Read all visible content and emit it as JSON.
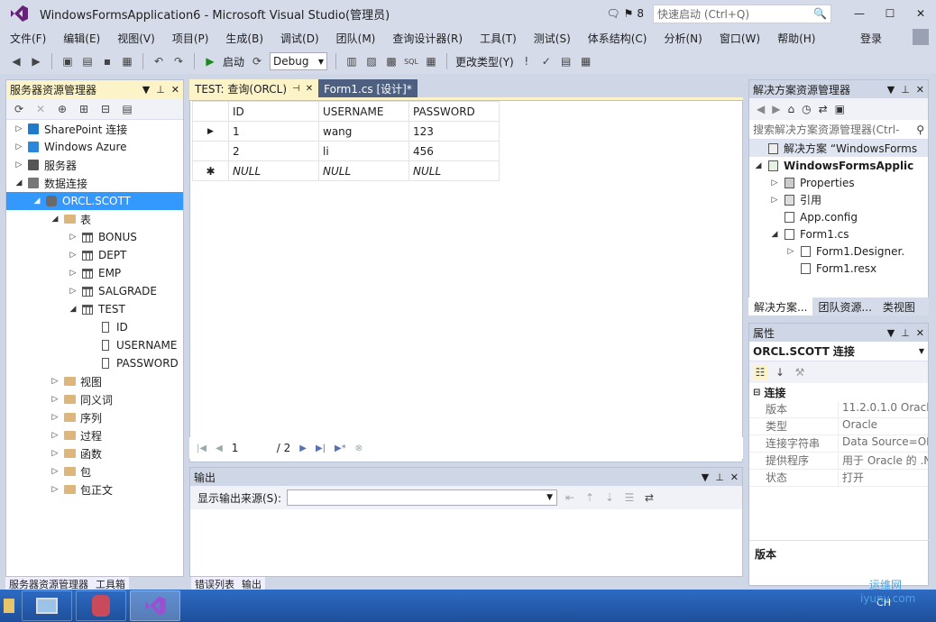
{
  "window": {
    "title": "WindowsFormsApplication6 - Microsoft Visual Studio(管理员)",
    "notification_count": "8",
    "quick_launch_placeholder": "快速启动 (Ctrl+Q)"
  },
  "menu": {
    "items": [
      "文件(F)",
      "编辑(E)",
      "视图(V)",
      "项目(P)",
      "生成(B)",
      "调试(D)",
      "团队(M)",
      "查询设计器(R)",
      "工具(T)",
      "测试(S)",
      "体系结构(C)",
      "分析(N)",
      "窗口(W)",
      "帮助(H)"
    ],
    "login": "登录"
  },
  "toolbar": {
    "start_label": "启动",
    "config": "Debug",
    "change_type": "更改类型(Y)"
  },
  "server_explorer": {
    "title": "服务器资源管理器",
    "tree": [
      {
        "label": "SharePoint 连接",
        "level": 0,
        "arrow": "collapsed",
        "icon": "sharepoint-icon"
      },
      {
        "label": "Windows Azure",
        "level": 0,
        "arrow": "collapsed",
        "icon": "azure-icon"
      },
      {
        "label": "服务器",
        "level": 0,
        "arrow": "collapsed",
        "icon": "server-icon"
      },
      {
        "label": "数据连接",
        "level": 0,
        "arrow": "expanded",
        "icon": "data-connection-icon"
      },
      {
        "label": "ORCL.SCOTT",
        "level": 1,
        "arrow": "expanded",
        "icon": "database-icon",
        "selected": true
      },
      {
        "label": "表",
        "level": 2,
        "arrow": "expanded",
        "icon": "folder-icon"
      },
      {
        "label": "BONUS",
        "level": 3,
        "arrow": "collapsed",
        "icon": "table-icon"
      },
      {
        "label": "DEPT",
        "level": 3,
        "arrow": "collapsed",
        "icon": "table-icon"
      },
      {
        "label": "EMP",
        "level": 3,
        "arrow": "collapsed",
        "icon": "table-icon"
      },
      {
        "label": "SALGRADE",
        "level": 3,
        "arrow": "collapsed",
        "icon": "table-icon"
      },
      {
        "label": "TEST",
        "level": 3,
        "arrow": "expanded",
        "icon": "table-icon"
      },
      {
        "label": "ID",
        "level": 4,
        "arrow": "none",
        "icon": "column-icon"
      },
      {
        "label": "USERNAME",
        "level": 4,
        "arrow": "none",
        "icon": "column-icon"
      },
      {
        "label": "PASSWORD",
        "level": 4,
        "arrow": "none",
        "icon": "column-icon"
      },
      {
        "label": "视图",
        "level": 2,
        "arrow": "collapsed",
        "icon": "folder-icon"
      },
      {
        "label": "同义词",
        "level": 2,
        "arrow": "collapsed",
        "icon": "folder-icon"
      },
      {
        "label": "序列",
        "level": 2,
        "arrow": "collapsed",
        "icon": "folder-icon"
      },
      {
        "label": "过程",
        "level": 2,
        "arrow": "collapsed",
        "icon": "folder-icon"
      },
      {
        "label": "函数",
        "level": 2,
        "arrow": "collapsed",
        "icon": "folder-icon"
      },
      {
        "label": "包",
        "level": 2,
        "arrow": "collapsed",
        "icon": "folder-icon"
      },
      {
        "label": "包正文",
        "level": 2,
        "arrow": "collapsed",
        "icon": "folder-icon"
      }
    ],
    "bottom_tabs": [
      "服务器资源管理器",
      "工具箱"
    ]
  },
  "doc_tabs": [
    {
      "label": "TEST: 查询(ORCL)",
      "active": true
    },
    {
      "label": "Form1.cs [设计]*",
      "active": false
    }
  ],
  "grid": {
    "columns": [
      "ID",
      "USERNAME",
      "PASSWORD"
    ],
    "rows": [
      {
        "marker": "▶",
        "cells": [
          "1",
          "wang",
          "123"
        ],
        "null": false
      },
      {
        "marker": "",
        "cells": [
          "2",
          "li",
          "456"
        ],
        "null": false
      },
      {
        "marker": "✱",
        "cells": [
          "NULL",
          "NULL",
          "NULL"
        ],
        "null": true
      }
    ],
    "pager": {
      "current": "1",
      "total": "/ 2"
    }
  },
  "output": {
    "title": "输出",
    "source_label": "显示输出来源(S):",
    "bottom_tabs": [
      "错误列表",
      "输出"
    ]
  },
  "solution_explorer": {
    "title": "解决方案资源管理器",
    "search_placeholder": "搜索解决方案资源管理器(Ctrl-",
    "tree": [
      {
        "label": "解决方案 “WindowsForms",
        "level": 0,
        "arrow": "none",
        "icon": "solution-icon"
      },
      {
        "label": "WindowsFormsApplic",
        "level": 0,
        "arrow": "expanded",
        "icon": "csharp-project-icon",
        "bold": true
      },
      {
        "label": "Properties",
        "level": 1,
        "arrow": "collapsed",
        "icon": "wrench-icon"
      },
      {
        "label": "引用",
        "level": 1,
        "arrow": "collapsed",
        "icon": "references-icon"
      },
      {
        "label": "App.config",
        "level": 1,
        "arrow": "none",
        "icon": "config-icon"
      },
      {
        "label": "Form1.cs",
        "level": 1,
        "arrow": "expanded",
        "icon": "form-icon"
      },
      {
        "label": "Form1.Designer.",
        "level": 2,
        "arrow": "collapsed",
        "icon": "file-icon"
      },
      {
        "label": "Form1.resx",
        "level": 2,
        "arrow": "none",
        "icon": "file-icon"
      }
    ],
    "tabs": [
      "解决方案...",
      "团队资源...",
      "类视图"
    ]
  },
  "properties": {
    "title": "属性",
    "object": "ORCL.SCOTT  连接",
    "category": "连接",
    "rows": [
      {
        "name": "版本",
        "value": "11.2.0.1.0 Oracle"
      },
      {
        "name": "类型",
        "value": "Oracle"
      },
      {
        "name": "连接字符串",
        "value": "Data Source=OR"
      },
      {
        "name": "提供程序",
        "value": "用于 Oracle 的 .N"
      },
      {
        "name": "状态",
        "value": "打开"
      }
    ],
    "description": "版本"
  },
  "taskbar": {
    "tray": "CH"
  },
  "watermark": {
    "line1": "运维网",
    "line2": "iyunv.com"
  }
}
